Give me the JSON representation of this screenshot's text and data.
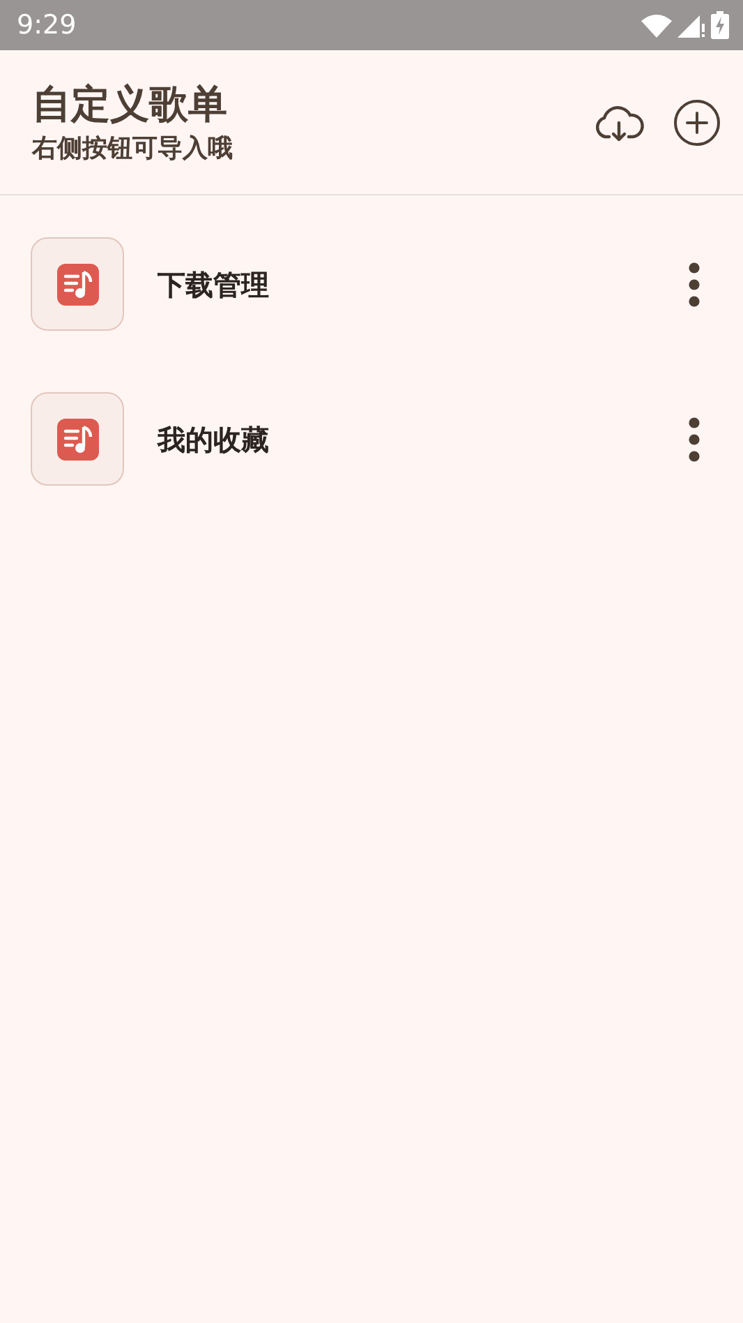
{
  "status_bar": {
    "time": "9:29"
  },
  "header": {
    "title": "自定义歌单",
    "subtitle": "右侧按钮可导入哦"
  },
  "playlists": [
    {
      "name": "下载管理"
    },
    {
      "name": "我的收藏"
    }
  ]
}
